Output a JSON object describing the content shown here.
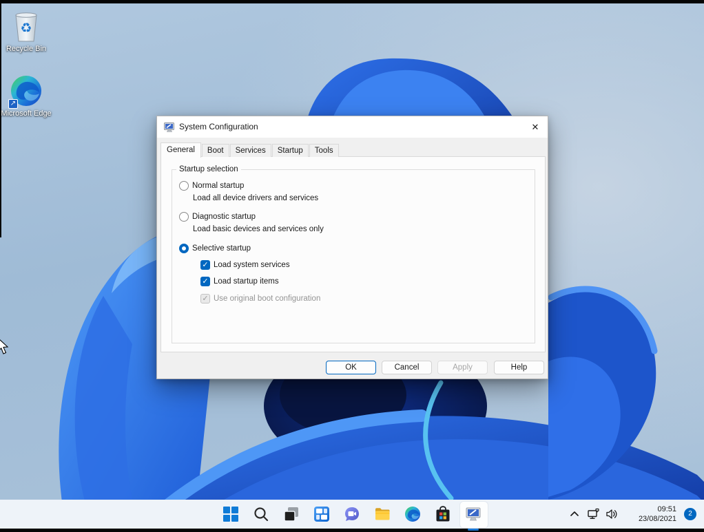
{
  "desktop": {
    "icons": [
      {
        "label": "Recycle Bin"
      },
      {
        "label": "Microsoft Edge"
      }
    ]
  },
  "dialog": {
    "title": "System Configuration",
    "tabs": [
      {
        "label": "General",
        "active": true
      },
      {
        "label": "Boot",
        "active": false
      },
      {
        "label": "Services",
        "active": false
      },
      {
        "label": "Startup",
        "active": false
      },
      {
        "label": "Tools",
        "active": false
      }
    ],
    "startup_selection": {
      "legend": "Startup selection",
      "normal": {
        "label": "Normal startup",
        "desc": "Load all device drivers and services",
        "selected": false
      },
      "diagnostic": {
        "label": "Diagnostic startup",
        "desc": "Load basic devices and services only",
        "selected": false
      },
      "selective": {
        "label": "Selective startup",
        "selected": true
      },
      "load_system_services": {
        "label": "Load system services",
        "checked": true,
        "disabled": false
      },
      "load_startup_items": {
        "label": "Load startup items",
        "checked": true,
        "disabled": false
      },
      "use_original_boot": {
        "label": "Use original boot configuration",
        "checked": true,
        "disabled": true
      }
    },
    "buttons": {
      "ok": "OK",
      "cancel": "Cancel",
      "apply": "Apply",
      "help": "Help"
    }
  },
  "taskbar": {
    "icons": [
      "start",
      "search",
      "task-view",
      "widgets",
      "chat",
      "file-explorer",
      "edge",
      "store",
      "system-configuration"
    ],
    "active_icon": "system-configuration",
    "tray": {
      "time": "09:51",
      "date": "23/08/2021",
      "badge": "2"
    }
  },
  "icons": {
    "check": "✓",
    "close": "✕",
    "recycle": "♻",
    "shortcut_arrow": "↗"
  },
  "colors": {
    "accent": "#0067c0",
    "taskbar_bg": "#eef3f9",
    "sky": "#a4bfd9",
    "bloom_bright": "#2e71ea",
    "bloom_dark": "#081540"
  }
}
